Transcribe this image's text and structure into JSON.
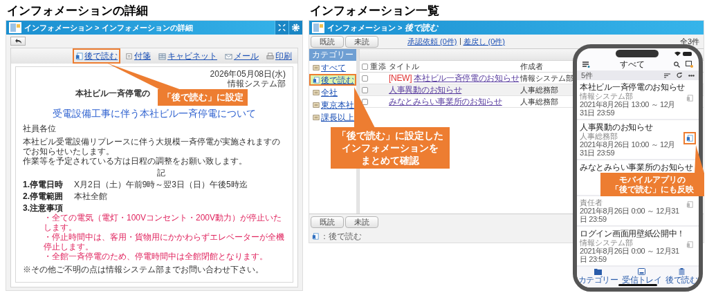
{
  "detail": {
    "heading": "インフォメーションの詳細",
    "breadcrumb": "インフォメーション > インフォメーションの詳細",
    "toolbar": [
      {
        "kind": "read_later",
        "label": "後で読む",
        "highlighted": true
      },
      {
        "kind": "sticky",
        "label": "付箋",
        "highlighted": false
      },
      {
        "kind": "cabinet",
        "label": "キャビネット",
        "highlighted": false
      },
      {
        "kind": "mail",
        "label": "メール",
        "highlighted": false
      },
      {
        "kind": "print",
        "label": "印刷",
        "highlighted": false
      }
    ],
    "document": {
      "date": "2026年05月08日(水)",
      "department": "情報システム部",
      "title": "本社ビル一斉停電の",
      "headline": "受電設備工事に伴う本社ビル一斉停電について",
      "salutation": "社員各位",
      "body": [
        "本社ビル受電設備リプレースに伴う大規模一斉停電が実施されますのでお知らせいたします。",
        "作業等を予定されている方は日程の調整をお願い致します。"
      ],
      "note_mark": "記",
      "items": [
        {
          "label": "1.停電日時",
          "value": "X月2日（土）午前9時～翌3日（日）午後5時迄"
        },
        {
          "label": "2.停電範囲",
          "value": "本社全館"
        },
        {
          "label": "3.注意事項",
          "bullets": [
            "・全ての電気（電灯・100Vコンセント・200V動力）が停止いたします。",
            "・停止時間中は、客用・貨物用にかかわらずエレベーターが全機停止します。",
            "・全館一斉停電のため、停電時間中は全館閉館となります。"
          ]
        }
      ],
      "footer": "※その他ご不明の点は情報システム部までお問い合わせ下さい。"
    }
  },
  "list": {
    "heading": "インフォメーション一覧",
    "breadcrumb_parent": "インフォメーション >",
    "breadcrumb_current": "後で読む",
    "buttons": [
      "既読",
      "未読"
    ],
    "links": [
      "承認依頼 (0件)",
      "差戻し (0件)"
    ],
    "total": "全3件",
    "category_header": "カテゴリー",
    "categories": [
      {
        "kind": "folder",
        "label": "すべて",
        "selected": false,
        "highlighted": false
      },
      {
        "kind": "read_later",
        "label": "後で読む",
        "selected": true,
        "highlighted": true
      },
      {
        "kind": "folder",
        "label": "全社",
        "selected": false,
        "highlighted": false
      },
      {
        "kind": "folder",
        "label": "東京本社",
        "selected": false,
        "highlighted": false
      },
      {
        "kind": "folder",
        "label": "課長以上",
        "selected": false,
        "highlighted": false
      }
    ],
    "select_all_checked": false,
    "columns": [
      "重",
      "添",
      "タイトル",
      "作成者"
    ],
    "rows": [
      {
        "checked": false,
        "badge": "[NEW]",
        "title": "本社ビル一斉停電のお知らせ",
        "author": "情報システム部"
      },
      {
        "checked": false,
        "title": "人事異動のお知らせ",
        "author": "人事総務部"
      },
      {
        "checked": false,
        "title": "みなとみらい事業所のお知らせ",
        "author": "人事総務部"
      }
    ],
    "footer_buttons": [
      "既読",
      "未読"
    ],
    "legend": "：後で読む"
  },
  "mobile": {
    "title": "すべて",
    "count": "5件",
    "items": [
      {
        "title": "本社ビル一斉停電のお知らせ",
        "department": "情報システム部",
        "period": "2021年8月26日 13:00 ～ 12月31日 23:59",
        "read_later": false,
        "highlighted": false
      },
      {
        "title": "人事異動のお知らせ",
        "department": "人事総務部",
        "period": "2021年8月26日 10:00 ～ 12月31日 23:59",
        "read_later": true,
        "highlighted": true
      },
      {
        "title": "みなとみらい事業所のお知らせ"
      },
      {
        "department": "責任者",
        "period": "2021年8月26日 0:00 ～ 12月31日 23:59",
        "read_later": false,
        "highlighted": false
      },
      {
        "title": "ログイン画面用壁紙公開中！",
        "department": "情報システム部",
        "period": "2021年8月26日 0:00 ～ 12月31日 23:59",
        "read_later": false,
        "highlighted": false
      }
    ],
    "tabs": [
      {
        "kind": "folder",
        "label": "カテゴリー"
      },
      {
        "kind": "inbox",
        "label": "受信トレイ"
      },
      {
        "kind": "clipboard",
        "label": "後で読む"
      }
    ]
  },
  "callouts": [
    {
      "lines": [
        "「後で読む」に設定"
      ]
    },
    {
      "lines": [
        "「後で読む」に設定した",
        "インフォメーションを",
        "まとめて確認"
      ]
    },
    {
      "lines": [
        "モバイルアプリの",
        "「後で読む」にも反映"
      ]
    }
  ]
}
